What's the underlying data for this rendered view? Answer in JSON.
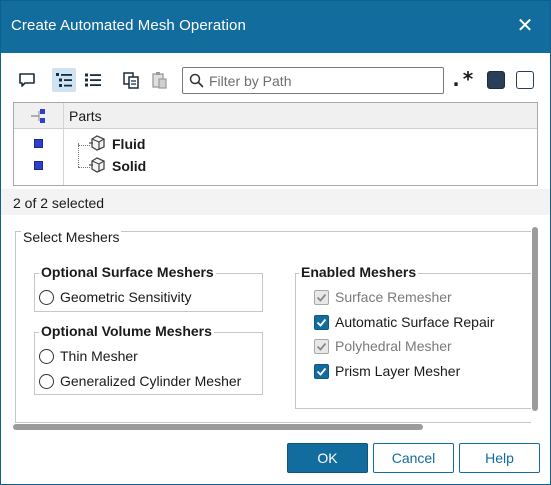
{
  "window": {
    "title": "Create Automated Mesh Operation"
  },
  "toolbar": {
    "search_placeholder": "Filter by Path",
    "regex_label": ".*"
  },
  "tree": {
    "column_header": "Parts",
    "items": [
      {
        "label": "Fluid"
      },
      {
        "label": "Solid"
      }
    ]
  },
  "status": {
    "selected_text": "2 of 2 selected"
  },
  "meshers": {
    "section_label": "Select Meshers",
    "optional_surface": {
      "label": "Optional Surface Meshers",
      "options": [
        "Geometric Sensitivity"
      ]
    },
    "optional_volume": {
      "label": "Optional Volume Meshers",
      "options": [
        "Thin Mesher",
        "Generalized Cylinder Mesher"
      ]
    },
    "enabled": {
      "label": "Enabled Meshers",
      "items": [
        {
          "label": "Surface Remesher",
          "checked": true,
          "enabled": false
        },
        {
          "label": "Automatic Surface Repair",
          "checked": true,
          "enabled": true
        },
        {
          "label": "Polyhedral Mesher",
          "checked": true,
          "enabled": false
        },
        {
          "label": "Prism Layer Mesher",
          "checked": true,
          "enabled": true
        }
      ]
    }
  },
  "buttons": {
    "ok": "OK",
    "cancel": "Cancel",
    "help": "Help"
  },
  "colors": {
    "accent": "#136c9e",
    "part_marker": "#2f3fc9"
  }
}
